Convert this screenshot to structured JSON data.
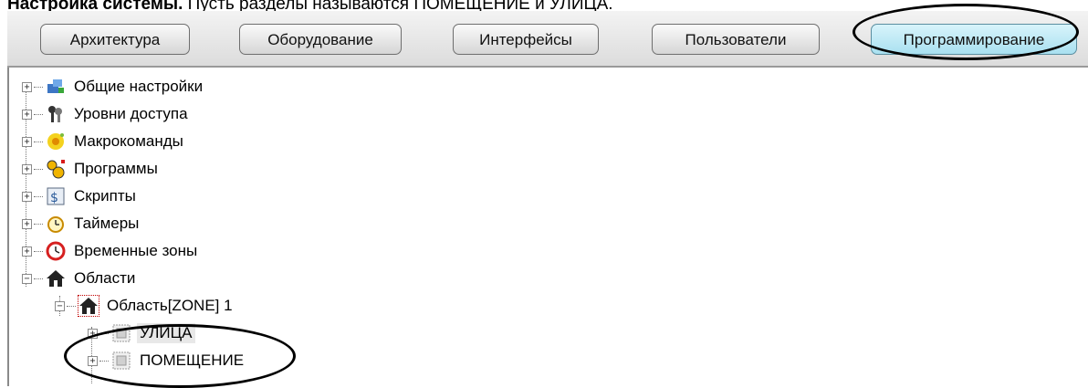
{
  "caption": {
    "bold_part": "Настройка системы.",
    "rest": " Пусть разделы называются ПОМЕЩЕНИЕ и УЛИЦА."
  },
  "tabs": [
    {
      "label": "Архитектура",
      "active": false
    },
    {
      "label": "Оборудование",
      "active": false
    },
    {
      "label": "Интерфейсы",
      "active": false
    },
    {
      "label": "Пользователи",
      "active": false
    },
    {
      "label": "Программирование",
      "active": true
    }
  ],
  "tree": {
    "items": [
      {
        "label": "Общие настройки",
        "icon": "settings-icon",
        "expander": "+"
      },
      {
        "label": "Уровни доступа",
        "icon": "keys-icon",
        "expander": "+"
      },
      {
        "label": "Макрокоманды",
        "icon": "macro-icon",
        "expander": "+"
      },
      {
        "label": "Программы",
        "icon": "programs-icon",
        "expander": "+"
      },
      {
        "label": "Скрипты",
        "icon": "script-icon",
        "expander": "+"
      },
      {
        "label": "Таймеры",
        "icon": "timer-icon",
        "expander": "+"
      },
      {
        "label": "Временные зоны",
        "icon": "clock-icon",
        "expander": "+"
      },
      {
        "label": "Области",
        "icon": "house-icon",
        "expander": "−"
      },
      {
        "label": "Область[ZONE] 1",
        "icon": "house-icon",
        "expander": "−"
      },
      {
        "label": "УЛИЦА",
        "icon": "partition-icon",
        "expander": "+"
      },
      {
        "label": "ПОМЕЩЕНИЕ",
        "icon": "partition-icon",
        "expander": "+"
      }
    ]
  },
  "colors": {
    "active_tab": "#a9e0f0",
    "tab_bg": "#dcdcdc",
    "highlight_oval": "#000000"
  }
}
